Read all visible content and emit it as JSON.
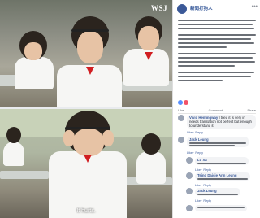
{
  "photo_top": {
    "watermark": "WSJ"
  },
  "photo_bottom": {
    "caption": "It hurts."
  },
  "post": {
    "page_name": "新聞打狗人",
    "meta": "",
    "reactions": "",
    "actions": [
      "Like",
      "Comment",
      "Share"
    ]
  },
  "comments": [
    {
      "name": "Vivid Hemingway",
      "text": "I tried it is very in needs translation not perfect but enough to understand it",
      "actions": "Like · Reply"
    },
    {
      "name": "Jack Leung",
      "text": "",
      "actions": "Like · Reply"
    },
    {
      "name": "Lu Xa",
      "text": "",
      "actions": "Like · Reply"
    },
    {
      "name": "Tsing Daisie Ann Leung",
      "text": "",
      "actions": "Like · Reply"
    },
    {
      "name": "Jack Leung",
      "text": "",
      "actions": "Like · Reply"
    },
    {
      "name": "",
      "text": "",
      "actions": "Like · Reply"
    }
  ],
  "colors": {
    "fb_blue": "#365899",
    "scarf_red": "#d11f22"
  }
}
